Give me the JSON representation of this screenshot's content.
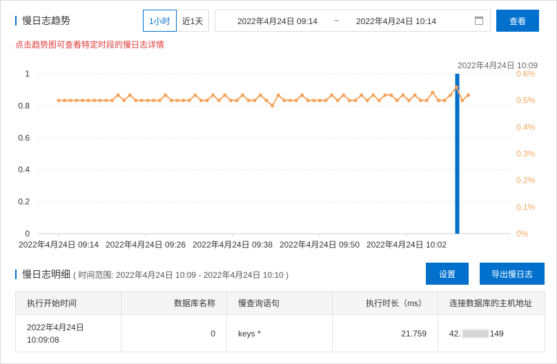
{
  "trend": {
    "title": "慢日志趋势",
    "ranges": [
      "1小时",
      "近1天"
    ],
    "date_start": "2022年4月24日 09:14",
    "date_sep": "~",
    "date_end": "2022年4月24日 10:14",
    "query_button": "查看",
    "hint": "点击趋势图可查看特定时段的慢日志详情",
    "tooltip": "2022年4月24日 10:09"
  },
  "chart_data": {
    "type": "bar+line",
    "x_ticks": [
      "2022年4月24日 09:14",
      "2022年4月24日 09:26",
      "2022年4月24日 09:38",
      "2022年4月24日 09:50",
      "2022年4月24日 10:02"
    ],
    "y_left_ticks": [
      "0",
      "0.2",
      "0.4",
      "0.6",
      "0.8",
      "1"
    ],
    "y_right_ticks": [
      "0%",
      "0.1%",
      "0.2%",
      "0.3%",
      "0.4%",
      "0.5%",
      "0.6%"
    ],
    "ylim_left": [
      0,
      1
    ],
    "ylim_right": [
      0,
      0.6
    ],
    "bar": {
      "minute_index": 55,
      "value": 1
    },
    "line_values": [
      0.5,
      0.5,
      0.5,
      0.5,
      0.5,
      0.5,
      0.5,
      0.5,
      0.5,
      0.5,
      0.52,
      0.5,
      0.52,
      0.5,
      0.5,
      0.5,
      0.5,
      0.5,
      0.52,
      0.5,
      0.5,
      0.5,
      0.5,
      0.52,
      0.5,
      0.5,
      0.52,
      0.5,
      0.52,
      0.5,
      0.5,
      0.52,
      0.5,
      0.5,
      0.52,
      0.5,
      0.48,
      0.52,
      0.5,
      0.5,
      0.5,
      0.52,
      0.5,
      0.5,
      0.5,
      0.5,
      0.52,
      0.5,
      0.52,
      0.5,
      0.5,
      0.52,
      0.5,
      0.52,
      0.5,
      0.52,
      0.52,
      0.5,
      0.52,
      0.5,
      0.52,
      0.5,
      0.5,
      0.53,
      0.5,
      0.5,
      0.52,
      0.55,
      0.5,
      0.52
    ],
    "colors": {
      "bar": "#0070cc",
      "line": "#f5a45d"
    },
    "grid": true
  },
  "details": {
    "title": "慢日志明细",
    "range_text": "( 时间范围: 2022年4月24日 10:09 - 2022年4月24日 10:10 )",
    "settings_button": "设置",
    "export_button": "导出慢日志",
    "columns": [
      "执行开始时间",
      "数据库名称",
      "慢查询语句",
      "执行时长（ms）",
      "连接数据库的主机地址"
    ],
    "rows": [
      {
        "start_date": "2022年4月24日",
        "start_time": "10:09:08",
        "db": "0",
        "query": "keys *",
        "duration": "21.759",
        "host_prefix": "42.",
        "host_suffix": "149"
      }
    ]
  }
}
